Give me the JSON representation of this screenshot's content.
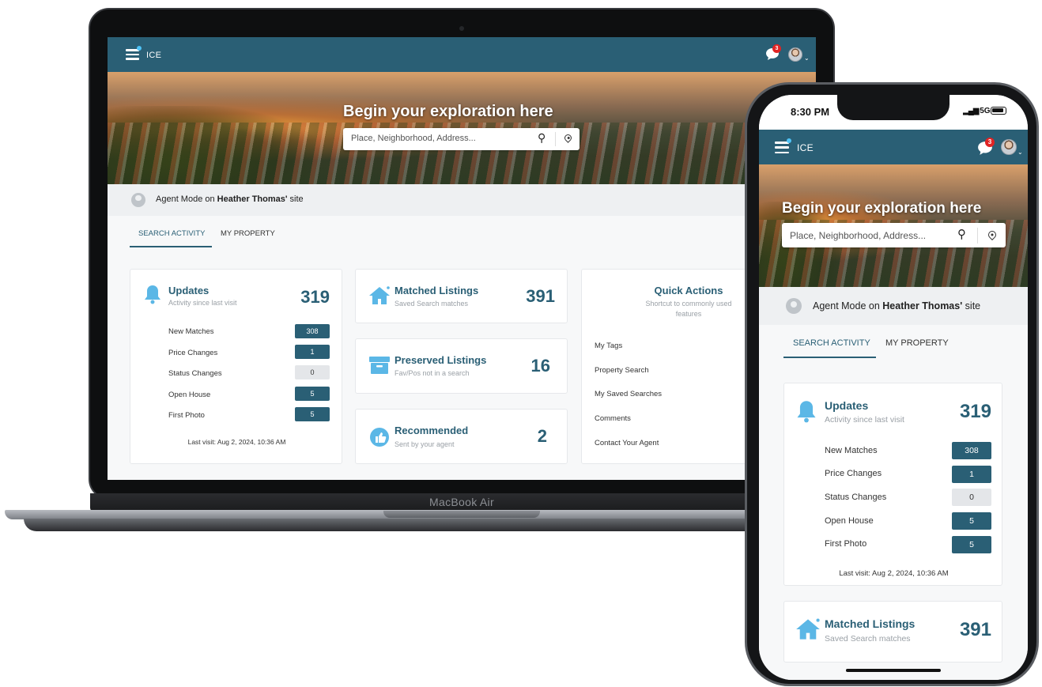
{
  "app": {
    "brand": "ICE",
    "notification_count": "3"
  },
  "hero": {
    "title": "Begin your exploration here",
    "search_placeholder": "Place, Neighborhood, Address..."
  },
  "agent": {
    "prefix": "Agent Mode on ",
    "name": "Heather Thomas'",
    "suffix": " site"
  },
  "tabs": [
    {
      "label": "SEARCH ACTIVITY",
      "active": true
    },
    {
      "label": "MY PROPERTY",
      "active": false
    }
  ],
  "updates": {
    "title": "Updates",
    "subtitle": "Activity since last visit",
    "count": "319",
    "rows": [
      {
        "label": "New Matches",
        "value": "308",
        "style": "dark"
      },
      {
        "label": "Price Changes",
        "value": "1",
        "style": "dark"
      },
      {
        "label": "Status Changes",
        "value": "0",
        "style": "light"
      },
      {
        "label": "Open House",
        "value": "5",
        "style": "dark"
      },
      {
        "label": "First Photo",
        "value": "5",
        "style": "dark"
      }
    ],
    "last_visit": "Last visit: Aug 2, 2024, 10:36 AM"
  },
  "matched": {
    "title": "Matched Listings",
    "subtitle": "Saved Search matches",
    "count": "391"
  },
  "preserved": {
    "title": "Preserved Listings",
    "subtitle": "Fav/Pos not in a search",
    "count": "16"
  },
  "recommended": {
    "title": "Recommended",
    "subtitle": "Sent by your agent",
    "count": "2"
  },
  "quick_actions": {
    "title": "Quick Actions",
    "subtitle": "Shortcut to commonly used features",
    "items": [
      "My Tags",
      "Property Search",
      "My Saved Searches",
      "Comments",
      "Contact Your Agent"
    ]
  },
  "device": {
    "laptop_label": "MacBook Air",
    "phone_time": "8:30 PM",
    "phone_signal": "5G"
  },
  "colors": {
    "primary": "#2a5f75",
    "accent_icon": "#5bb7e6",
    "badge": "#e02424"
  }
}
